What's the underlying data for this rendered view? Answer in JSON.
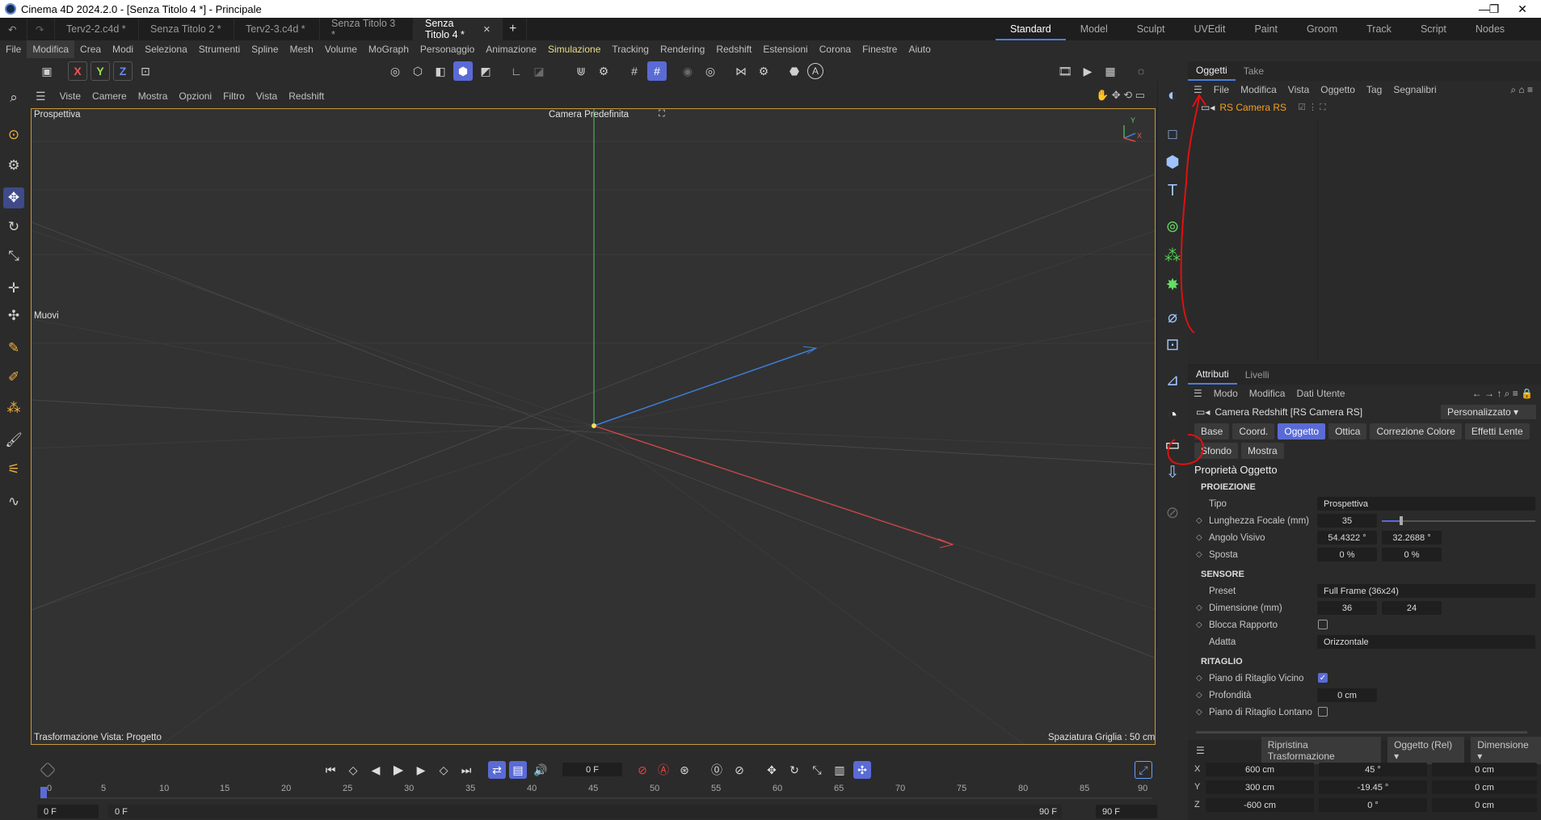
{
  "window": {
    "title": "Cinema 4D 2024.2.0 - [Senza Titolo 4 *] - Principale",
    "min": "—",
    "restore": "❐",
    "close": "✕"
  },
  "doc_tabs": [
    {
      "label": "Terv2-2.c4d *"
    },
    {
      "label": "Senza Titolo 2 *"
    },
    {
      "label": "Terv2-3.c4d *"
    },
    {
      "label": "Senza Titolo 3 *"
    },
    {
      "label": "Senza Titolo 4 *",
      "active": true
    }
  ],
  "layouts": [
    "Standard",
    "Model",
    "Sculpt",
    "UVEdit",
    "Paint",
    "Groom",
    "Track",
    "Script",
    "Nodes"
  ],
  "menu": [
    "File",
    "Modifica",
    "Crea",
    "Modi",
    "Seleziona",
    "Strumenti",
    "Spline",
    "Mesh",
    "Volume",
    "MoGraph",
    "Personaggio",
    "Animazione",
    "Simulazione",
    "Tracking",
    "Rendering",
    "Redshift",
    "Estensioni",
    "Corona",
    "Finestre",
    "Aiuto"
  ],
  "axis_buttons": [
    "X",
    "Y",
    "Z"
  ],
  "viewport_menu": [
    "Viste",
    "Camere",
    "Mostra",
    "Opzioni",
    "Filtro",
    "Vista",
    "Redshift"
  ],
  "viewport": {
    "view_name": "Prospettiva",
    "camera": "Camera Predefinita",
    "tool": "Muovi",
    "transform_info": "Trasformazione Vista: Progetto",
    "grid_spacing": "Spaziatura Griglia : 50 cm",
    "axis_y": "Y",
    "axis_x": "X"
  },
  "objects_panel": {
    "tabs": [
      "Oggetti",
      "Take"
    ],
    "menu": [
      "File",
      "Modifica",
      "Vista",
      "Oggetto",
      "Tag",
      "Segnalibri"
    ],
    "object": "RS Camera RS"
  },
  "attributes_panel": {
    "tabs": [
      "Attributi",
      "Livelli"
    ],
    "menu": [
      "Modo",
      "Modifica",
      "Dati Utente"
    ],
    "object_title": "Camera Redshift [RS Camera RS]",
    "preset": "Personalizzato",
    "tab_buttons_row1": [
      "Base",
      "Coord.",
      "Oggetto",
      "Ottica",
      "Correzione Colore",
      "Effetti Lente"
    ],
    "tab_buttons_row2": [
      "Sfondo",
      "Mostra"
    ],
    "active_tab": "Oggetto",
    "section": "Proprietà Oggetto",
    "proiezione": {
      "heading": "PROIEZIONE",
      "tipo_label": "Tipo",
      "tipo": "Prospettiva",
      "focale_label": "Lunghezza Focale (mm)",
      "focale": "35",
      "angolo_label": "Angolo Visivo",
      "angolo_h": "54.4322 °",
      "angolo_v": "32.2688 °",
      "sposta_label": "Sposta",
      "sposta_x": "0 %",
      "sposta_y": "0 %"
    },
    "sensore": {
      "heading": "SENSORE",
      "preset_label": "Preset",
      "preset": "Full Frame (36x24)",
      "dim_label": "Dimensione (mm)",
      "dim_w": "36",
      "dim_h": "24",
      "blocca_label": "Blocca Rapporto",
      "adatta_label": "Adatta",
      "adatta": "Orizzontale"
    },
    "ritaglio": {
      "heading": "RITAGLIO",
      "vicino_label": "Piano di Ritaglio Vicino",
      "prof_label": "Profondità",
      "prof": "0 cm",
      "lontano_label": "Piano di Ritaglio Lontano"
    }
  },
  "coords": {
    "reset": "Ripristina Trasformazione",
    "mode": "Oggetto (Rel)",
    "size": "Dimensione",
    "rows": [
      {
        "axis": "X",
        "pos": "600 cm",
        "rot": "45 °",
        "dim": "0 cm"
      },
      {
        "axis": "Y",
        "pos": "300 cm",
        "rot": "-19.45 °",
        "dim": "0 cm"
      },
      {
        "axis": "Z",
        "pos": "-600 cm",
        "rot": "0 °",
        "dim": "0 cm"
      }
    ]
  },
  "timeline": {
    "current_frame": "0 F",
    "ticks": [
      "0",
      "5",
      "10",
      "15",
      "20",
      "25",
      "30",
      "35",
      "40",
      "45",
      "50",
      "55",
      "60",
      "65",
      "70",
      "75",
      "80",
      "85",
      "90"
    ],
    "start": "0 F",
    "start2": "0 F",
    "end": "90 F",
    "end2": "90 F"
  }
}
